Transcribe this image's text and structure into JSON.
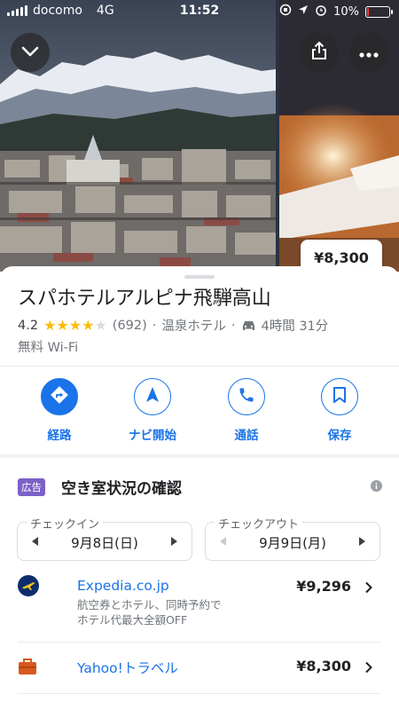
{
  "status_bar": {
    "carrier": "docomo",
    "network": "4G",
    "time": "11:52",
    "battery": "10%",
    "battery_level": 0.1
  },
  "header": {
    "price_tag": "¥8,300"
  },
  "place": {
    "name": "スパホテルアルピナ飛騨高山",
    "rating": "4.2",
    "stars": 4,
    "review_count": "(692)",
    "category": "温泉ホテル",
    "drive_time": "4時間 31分",
    "amenity": "無料 Wi-Fi"
  },
  "actions": [
    {
      "label": "経路",
      "icon": "directions-icon"
    },
    {
      "label": "ナビ開始",
      "icon": "navigation-icon"
    },
    {
      "label": "通話",
      "icon": "phone-icon"
    },
    {
      "label": "保存",
      "icon": "bookmark-icon"
    }
  ],
  "availability": {
    "ad_badge": "広告",
    "title": "空き室状況の確認",
    "checkin_label": "チェックイン",
    "checkin_date": "9月8日(日)",
    "checkout_label": "チェックアウト",
    "checkout_date": "9月9日(月)"
  },
  "offers": [
    {
      "name": "Expedia.co.jp",
      "desc1": "航空券とホテル、同時予約で",
      "desc2": "ホテル代最大全額OFF",
      "price": "¥9,296"
    },
    {
      "name": "Yahoo!トラベル",
      "price": "¥8,300"
    }
  ],
  "colors": {
    "accent": "#1a73e8",
    "star": "#fbbc04",
    "ad_badge": "#7b61c8",
    "battery_low": "#ff3b30"
  }
}
